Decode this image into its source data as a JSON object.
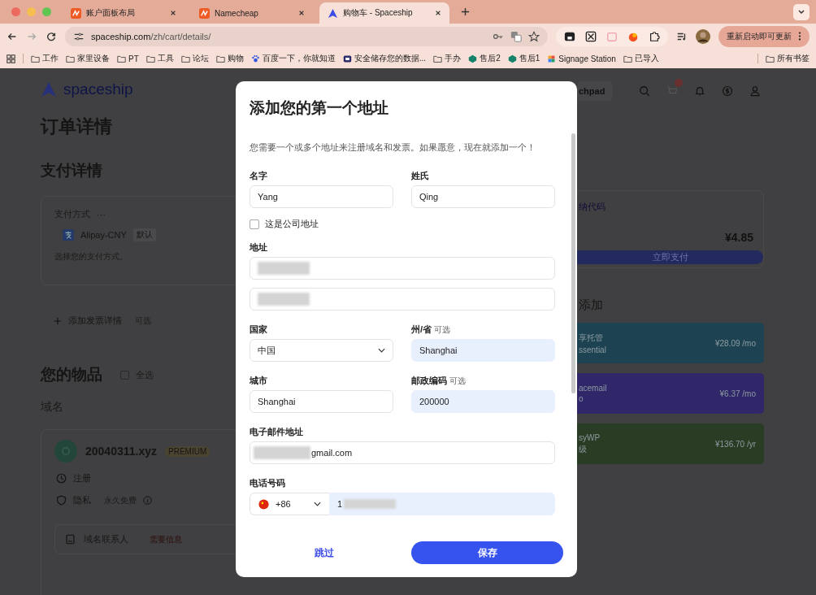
{
  "browser": {
    "tabs": [
      {
        "title": "账户面板布局",
        "selected": false
      },
      {
        "title": "Namecheap",
        "selected": false
      },
      {
        "title": "购物车 - Spaceship",
        "selected": true
      }
    ],
    "url_host": "spaceship.com",
    "url_path": "/zh/cart/details/",
    "update_button": "重新启动即可更新",
    "bookmarks": [
      {
        "label": "工作",
        "kind": "folder"
      },
      {
        "label": "家里设备",
        "kind": "folder"
      },
      {
        "label": "PT",
        "kind": "folder"
      },
      {
        "label": "工具",
        "kind": "folder"
      },
      {
        "label": "论坛",
        "kind": "folder"
      },
      {
        "label": "购物",
        "kind": "folder"
      },
      {
        "label": "百度一下，你就知道",
        "kind": "paw"
      },
      {
        "label": "安全储存您的数据...",
        "kind": "app"
      },
      {
        "label": "手办",
        "kind": "folder"
      },
      {
        "label": "售后2",
        "kind": "s"
      },
      {
        "label": "售后1",
        "kind": "s"
      },
      {
        "label": "Signage Station",
        "kind": "grid"
      },
      {
        "label": "已导入",
        "kind": "folder"
      }
    ],
    "all_bookmarks": "所有书签"
  },
  "page": {
    "logo": "spaceship",
    "title": "订单详情",
    "payment_heading": "支付详情",
    "payment_label": "支付方式",
    "payment_more": "···",
    "method": "Alipay-CNY",
    "method_badge": "默认",
    "method_hint": "选择您的支付方式。",
    "add_invoice": "添加发票详情",
    "add_invoice_optional": "可选",
    "items_heading": "您的物品",
    "select_all": {
      "label": "全选",
      "checked": false
    },
    "domains_label": "域名",
    "domain": {
      "name": "20040311.xyz",
      "badge": "PREMIUM",
      "rows": [
        {
          "label": "注册",
          "kind": "clock"
        },
        {
          "label": "隐私",
          "note": "永久免费",
          "kind": "shield"
        }
      ],
      "contacts": "域名联系人",
      "contacts_status": "需要信息"
    },
    "nav_button": "chpad",
    "promo": "纳代码",
    "total": "¥4.85",
    "pay_button": "立即支付",
    "addons_heading": "添加",
    "addons": [
      {
        "name": "享托管",
        "sub": "ssential",
        "price": "¥28.09 /mo",
        "color": "#1d4352"
      },
      {
        "name": "acemail",
        "sub": "o",
        "price": "¥6.37 /mo",
        "color": "#30266a"
      },
      {
        "name": "syWP",
        "sub": "级",
        "price": "¥136.70 /yr",
        "color": "#283d24"
      }
    ]
  },
  "modal": {
    "title": "添加您的第一个地址",
    "intro": "您需要一个或多个地址来注册域名和发票。如果愿意，现在就添加一个！",
    "rows": [
      [
        {
          "kind": "text",
          "label": "名字",
          "value": "Yang",
          "autofilled": false,
          "redacted": false
        },
        {
          "kind": "text",
          "label": "姓氏",
          "value": "Qing",
          "autofilled": false,
          "redacted": false
        }
      ],
      [
        {
          "kind": "checkbox",
          "label": "这是公司地址",
          "checked": false
        }
      ],
      [
        {
          "kind": "text",
          "label": "地址",
          "autofilled": false,
          "redacted": true
        }
      ],
      [
        {
          "kind": "text",
          "autofilled": false,
          "redacted": true
        }
      ],
      [
        {
          "kind": "select",
          "label": "国家",
          "value": "中国",
          "autofilled": false,
          "redacted": false
        },
        {
          "kind": "text",
          "label": "州/省",
          "optional": "可选",
          "value": "Shanghai",
          "autofilled": true,
          "redacted": false
        }
      ],
      [
        {
          "kind": "text",
          "label": "城市",
          "value": "Shanghai",
          "autofilled": false,
          "redacted": false
        },
        {
          "kind": "text",
          "label": "邮政编码",
          "optional": "可选",
          "value": "200000",
          "autofilled": true,
          "redacted": false
        }
      ],
      [
        {
          "kind": "text",
          "label": "电子邮件地址",
          "value": "gmail.com",
          "autofilled": false,
          "redacted": true
        }
      ],
      [
        {
          "kind": "phone",
          "label": "电话号码",
          "code": "+86",
          "value": "1",
          "autofilled": true,
          "redacted": true
        }
      ]
    ],
    "skip": "跳过",
    "save": "保存"
  }
}
